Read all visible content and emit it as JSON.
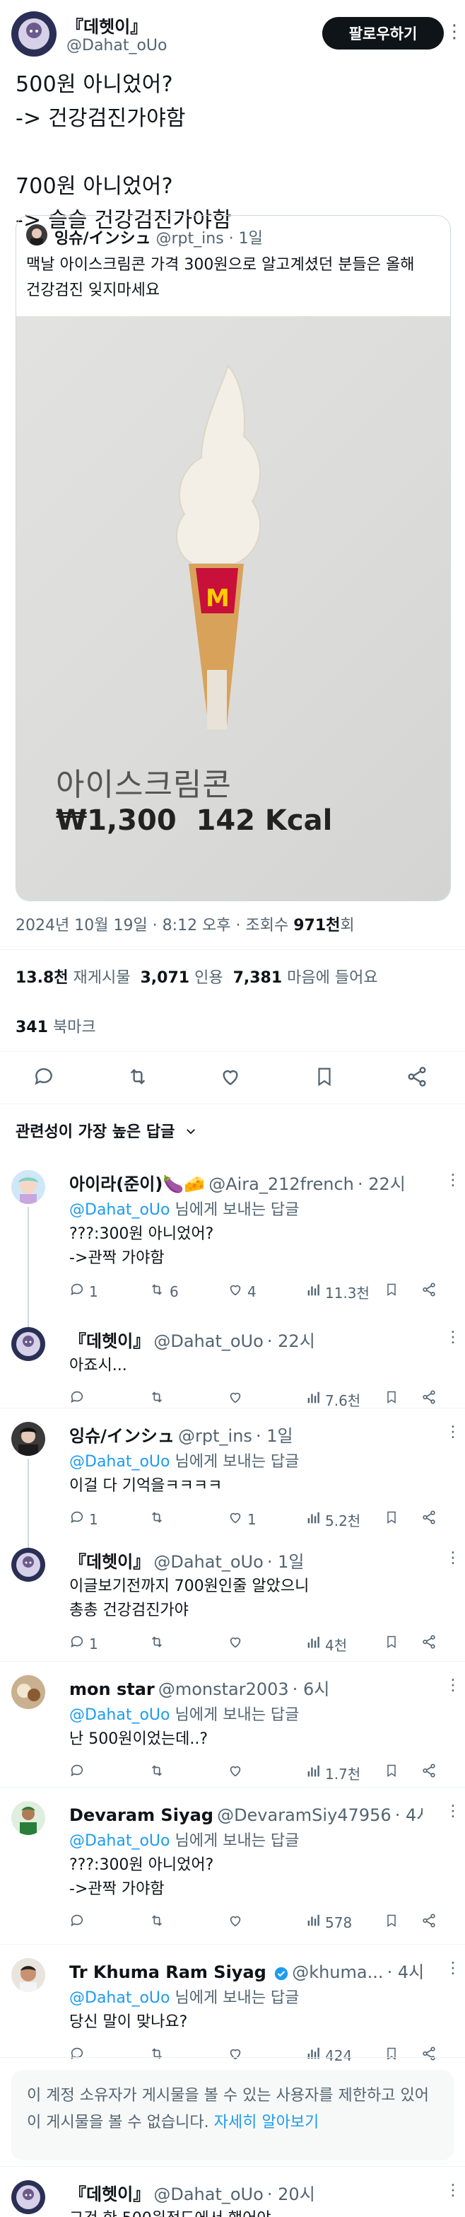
{
  "tweet": {
    "author_name": "『데헷이』",
    "author_handle": "@Dahat_oUo",
    "follow_label": "팔로우하기",
    "text": "500원 아니었어?\n-> 건강검진가야함\n\n700원 아니었어?\n-> 슬슬 건강검진가야함",
    "timestamp": "2024년 10월 19일 · 8:12 오후 · 조회수 ",
    "views": "971천",
    "views_suffix": "회",
    "stats": {
      "reposts_value": "13.8천",
      "reposts_label": "재게시물",
      "quotes_value": "3,071",
      "quotes_label": "인용",
      "likes_value": "7,381",
      "likes_label": "마음에 들어요",
      "bookmarks_value": "341",
      "bookmarks_label": "북마크"
    }
  },
  "quoted": {
    "author_name": "잉슈/インシュ",
    "author_handle": "@rpt_ins",
    "time": "· 1일",
    "text": "맥날 아이스크림콘 가격 300원으로 알고계셨던 분들은 올해 건강검진 잊지마세요",
    "image_caption": "아이스크림콘",
    "image_price": "₩1,300  142 Kcal"
  },
  "sort": {
    "label": "관련성이 가장 높은 답글"
  },
  "reply_to_label": "님에게 보내는 답글",
  "replies": [
    {
      "name": "아이라(준이)🍆🧀",
      "handle": "@Aira_212french",
      "time": "· 22시",
      "reply_to": "@Dahat_oUo",
      "text": "???:300원 아니었어?\n->관짝 가야함",
      "replies": "1",
      "reposts": "6",
      "likes": "4",
      "views": "11.3천"
    },
    {
      "name": "『데헷이』",
      "handle": "@Dahat_oUo",
      "time": "· 22시",
      "reply_to": "",
      "text": "아죠시...",
      "replies": "",
      "reposts": "",
      "likes": "",
      "views": "7.6천"
    },
    {
      "name": "잉슈/インシュ",
      "handle": "@rpt_ins",
      "time": "· 1일",
      "reply_to": "@Dahat_oUo",
      "text": "이걸 다 기억을ㅋㅋㅋㅋ",
      "replies": "1",
      "reposts": "",
      "likes": "1",
      "views": "5.2천"
    },
    {
      "name": "『데헷이』",
      "handle": "@Dahat_oUo",
      "time": "· 1일",
      "reply_to": "",
      "text": "이글보기전까지 700원인줄 알았으니\n총총 건강검진가야",
      "replies": "1",
      "reposts": "",
      "likes": "",
      "views": "4천"
    },
    {
      "name": "mon star",
      "handle": "@monstar2003",
      "time": "· 6시",
      "reply_to": "@Dahat_oUo",
      "text": "난 500원이었는데..?",
      "replies": "",
      "reposts": "",
      "likes": "",
      "views": "1.7천"
    },
    {
      "name": "Devaram Siyag",
      "handle": "@DevaramSiy47956",
      "time": "· 4시",
      "reply_to": "@Dahat_oUo",
      "text": "???:300원 아니었어?\n->관짝 가야함",
      "replies": "",
      "reposts": "",
      "likes": "",
      "views": "578"
    },
    {
      "name": "Tr Khuma Ram Siyag ",
      "handle": "@khuma...",
      "time": "· 4시",
      "reply_to": "@Dahat_oUo",
      "text": "당신 말이 맞나요?",
      "replies": "",
      "reposts": "",
      "likes": "",
      "views": "424"
    },
    {
      "name": "『데헷이』",
      "handle": "@Dahat_oUo",
      "time": "· 20시",
      "reply_to": "",
      "text": "그건 한 500원정도에서 했어야...",
      "replies": "",
      "reposts": "",
      "likes": "",
      "views": ""
    }
  ],
  "notice": {
    "text": "이 계정 소유자가 게시물을 볼 수 있는 사용자를 제한하고 있어 이 게시물을 볼 수 없습니다. ",
    "link": "자세히 알아보기"
  },
  "colors": {
    "link_blue": "#1d9bf0",
    "text_dark": "#0f1419",
    "text_grey": "#536471"
  }
}
